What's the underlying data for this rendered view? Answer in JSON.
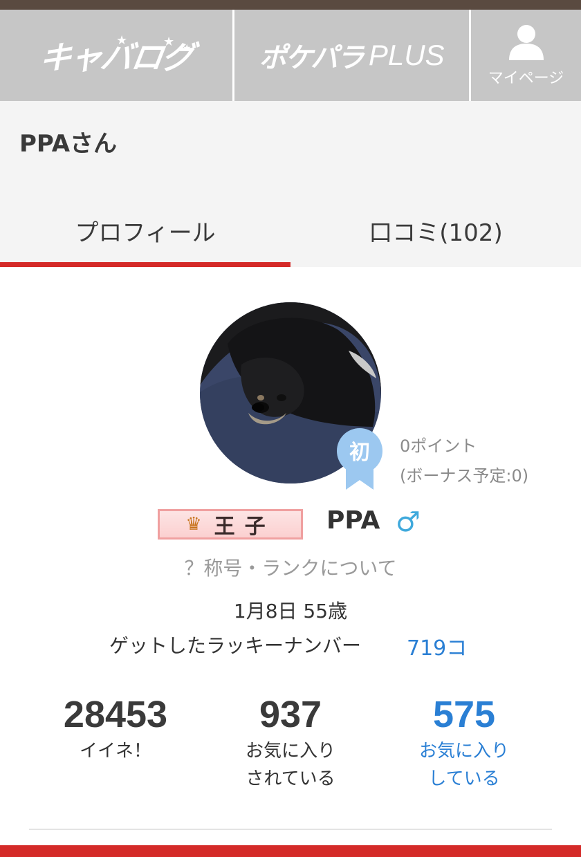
{
  "nav": {
    "cabalog_logo": "キャバログ",
    "pokepara_logo": "ポケパラ",
    "pokepara_plus": "PLUS",
    "mypage_label": "マイページ"
  },
  "user": {
    "header_name": "PPAさん",
    "nickname": "PPA",
    "gender_symbol": "♂",
    "title": "王子",
    "rank_link": "？称号・ランクについて",
    "birth_age": "1月8日 55歳",
    "lucky_label": "ゲットしたラッキーナンバー",
    "lucky_count": "719コ",
    "badge_label": "初",
    "points": "0ポイント",
    "bonus": "(ボーナス予定:0)"
  },
  "tabs": [
    {
      "label": "プロフィール",
      "active": true
    },
    {
      "label": "口コミ(102)",
      "active": false
    }
  ],
  "stats": [
    {
      "value": "28453",
      "label_line1": "イイネ！",
      "label_line2": ""
    },
    {
      "value": "937",
      "label_line1": "お気に入り",
      "label_line2": "されている"
    },
    {
      "value": "575",
      "label_line1": "お気に入り",
      "label_line2": "している"
    }
  ],
  "colors": {
    "accent_red": "#d42a28",
    "link_blue": "#2a7fd4",
    "badge_blue": "#9cc8f0",
    "nav_gray": "#c6c6c6"
  }
}
